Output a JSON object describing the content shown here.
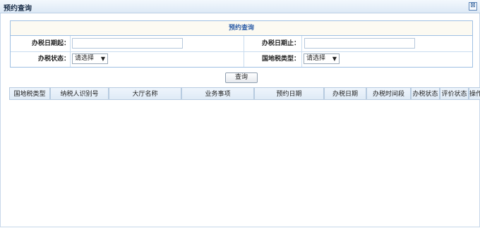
{
  "window": {
    "title": "预约查询",
    "close_icon": "⊠"
  },
  "form": {
    "title": "预约查询",
    "start_date_label": "办税日期起：",
    "start_date_value": "",
    "end_date_label": "办税日期止：",
    "end_date_value": "",
    "status_label": "办税状态：",
    "status_value": "请选择",
    "tax_type_label": "国地税类型：",
    "tax_type_value": "请选择"
  },
  "query_button": "查询",
  "table": {
    "columns": [
      "国地税类型",
      "纳税人识别号",
      "大厅名称",
      "业务事项",
      "预约日期",
      "办税日期",
      "办税时间段",
      "办税状态",
      "评价状态",
      "操作"
    ]
  }
}
